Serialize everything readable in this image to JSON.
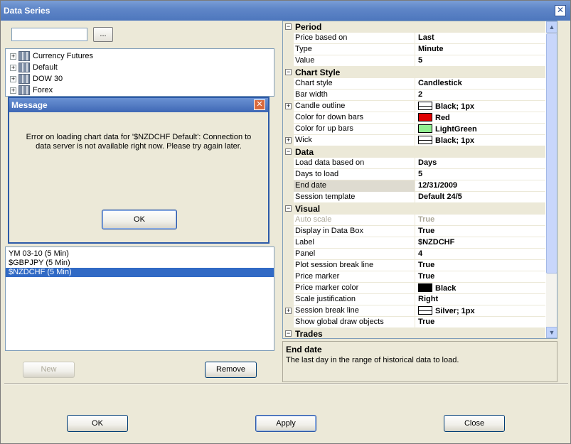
{
  "window": {
    "title": "Data Series",
    "close_glyph": "✕"
  },
  "left": {
    "search_value": "",
    "browse_label": "...",
    "instruments": [
      {
        "label": "Currency Futures"
      },
      {
        "label": "Default"
      },
      {
        "label": "DOW 30"
      },
      {
        "label": "Forex"
      }
    ],
    "series": [
      {
        "label": "YM 03-10 (5 Min)"
      },
      {
        "label": "$GBPJPY (5 Min)"
      },
      {
        "label": "$NZDCHF (5 Min)"
      }
    ],
    "new_label": "New",
    "remove_label": "Remove"
  },
  "message": {
    "title": "Message",
    "close_glyph": "✕",
    "text": "Error on loading chart data for '$NZDCHF Default': Connection to data server is not available right now. Please try again later.",
    "ok_label": "OK"
  },
  "properties": {
    "rows": [
      {
        "kind": "category",
        "name": "Period"
      },
      {
        "name": "Price based on",
        "value": "Last"
      },
      {
        "name": "Type",
        "value": "Minute"
      },
      {
        "name": "Value",
        "value": "5"
      },
      {
        "kind": "category",
        "name": "Chart Style"
      },
      {
        "name": "Chart style",
        "value": "Candlestick"
      },
      {
        "name": "Bar width",
        "value": "2"
      },
      {
        "name": "Candle outline",
        "value": "Black; 1px",
        "expandable": true,
        "swatch": "line"
      },
      {
        "name": "Color for down bars",
        "value": "Red",
        "swatch": "#e00000"
      },
      {
        "name": "Color for up bars",
        "value": "LightGreen",
        "swatch": "#90ee90"
      },
      {
        "name": "Wick",
        "value": "Black; 1px",
        "expandable": true,
        "swatch": "line"
      },
      {
        "kind": "category",
        "name": "Data"
      },
      {
        "name": "Load data based on",
        "value": "Days"
      },
      {
        "name": "Days to load",
        "value": "5"
      },
      {
        "name": "End date",
        "value": "12/31/2009",
        "highlight": true
      },
      {
        "name": "Session template",
        "value": "Default 24/5"
      },
      {
        "kind": "category",
        "name": "Visual"
      },
      {
        "name": "Auto scale",
        "value": "True",
        "disabled": true
      },
      {
        "name": "Display in Data Box",
        "value": "True"
      },
      {
        "name": "Label",
        "value": "$NZDCHF"
      },
      {
        "name": "Panel",
        "value": "4"
      },
      {
        "name": "Plot session break line",
        "value": "True"
      },
      {
        "name": "Price marker",
        "value": "True"
      },
      {
        "name": "Price marker color",
        "value": "Black",
        "swatch": "#000000"
      },
      {
        "name": "Scale justification",
        "value": "Right"
      },
      {
        "name": "Session break line",
        "value": "Silver; 1px",
        "expandable": true,
        "swatch": "line"
      },
      {
        "name": "Show global draw objects",
        "value": "True"
      },
      {
        "kind": "category",
        "name": "Trades"
      }
    ],
    "category_glyph": "⊟",
    "expand_glyph": "+",
    "scroll_up_glyph": "▲",
    "scroll_down_glyph": "▼"
  },
  "description": {
    "title": "End date",
    "text": "The last day in the range of historical data to load."
  },
  "footer": {
    "ok_label": "OK",
    "apply_label": "Apply",
    "close_label": "Close"
  }
}
